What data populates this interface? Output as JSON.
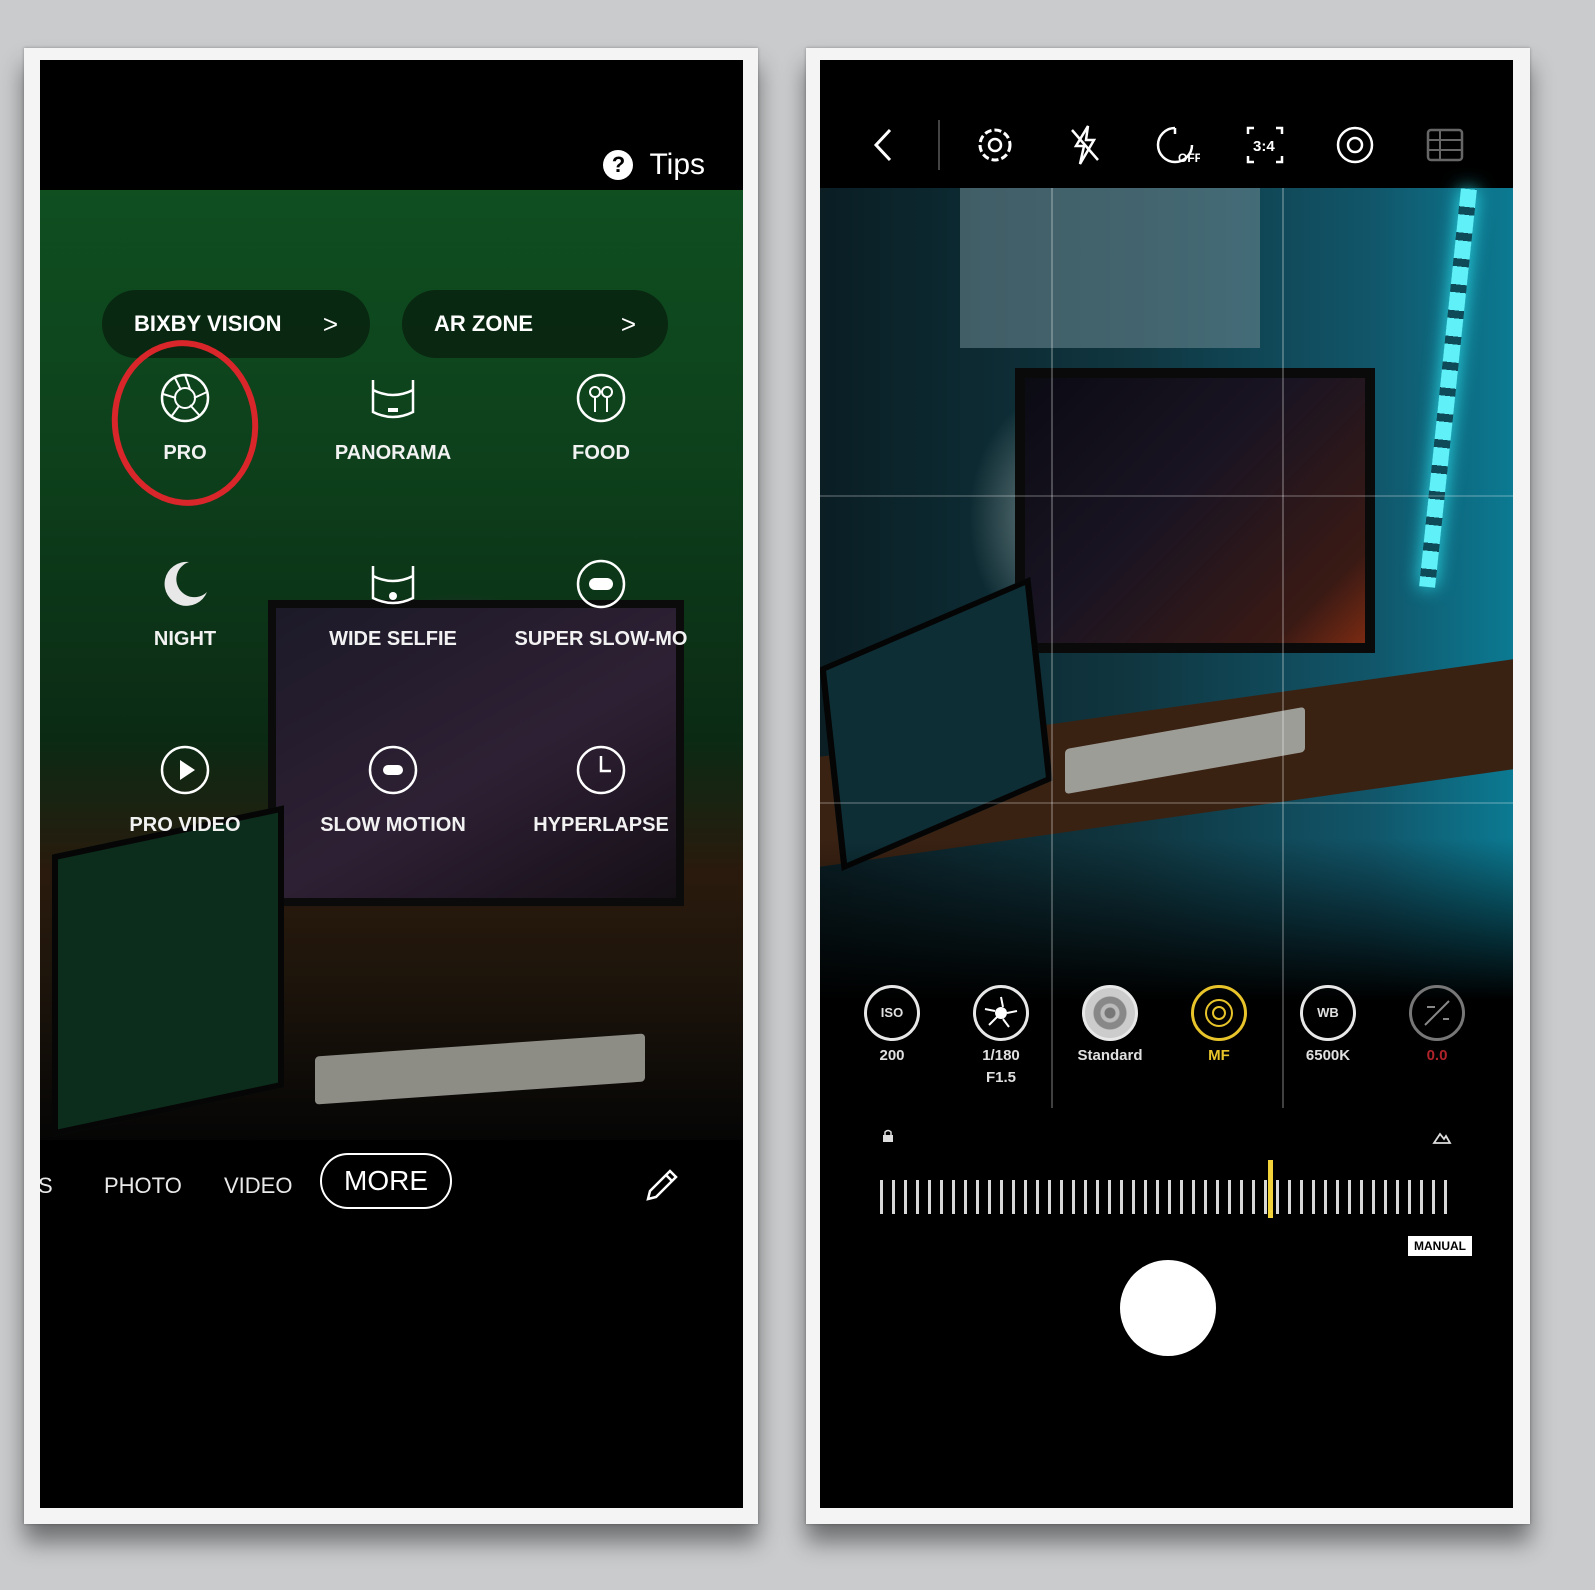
{
  "left": {
    "tips_label": "Tips",
    "shortcuts": [
      {
        "label": "BIXBY VISION",
        "chevron": ">"
      },
      {
        "label": "AR ZONE",
        "chevron": ">"
      }
    ],
    "modes": [
      {
        "label": "PRO",
        "icon": "aperture-icon"
      },
      {
        "label": "PANORAMA",
        "icon": "panorama-icon"
      },
      {
        "label": "FOOD",
        "icon": "food-icon"
      },
      {
        "label": "NIGHT",
        "icon": "moon-icon"
      },
      {
        "label": "WIDE SELFIE",
        "icon": "wide-selfie-icon"
      },
      {
        "label": "SUPER SLOW-MO",
        "icon": "super-slow-mo-icon"
      },
      {
        "label": "PRO VIDEO",
        "icon": "play-icon"
      },
      {
        "label": "SLOW MOTION",
        "icon": "slow-motion-icon"
      },
      {
        "label": "HYPERLAPSE",
        "icon": "hyperlapse-icon"
      }
    ],
    "highlight_color": "#d9262a",
    "modebar": {
      "partial": "S",
      "photo": "PHOTO",
      "video": "VIDEO",
      "more": "MORE"
    }
  },
  "right": {
    "topbar_icons": [
      "back-icon",
      "settings-icon",
      "flash-off-icon",
      "timer-off-icon",
      "ratio-icon",
      "filter-icon",
      "motion-photo-icon"
    ],
    "ratio_label": "3:4",
    "timer_label": "OFF",
    "pro_controls": [
      {
        "icon_text": "ISO",
        "label": "200"
      },
      {
        "icon_text": "",
        "label": "1/180",
        "label2": "F1.5"
      },
      {
        "icon_text": "",
        "label": "Standard"
      },
      {
        "icon_text": "",
        "label": "MF",
        "color": "#e8c42a"
      },
      {
        "icon_text": "WB",
        "label": "6500K"
      },
      {
        "icon_text": "",
        "label": "0.0",
        "color": "#b0232a"
      }
    ],
    "focus_level": 0.68,
    "accent_color": "#f2d43a",
    "manual_label": "MANUAL"
  }
}
